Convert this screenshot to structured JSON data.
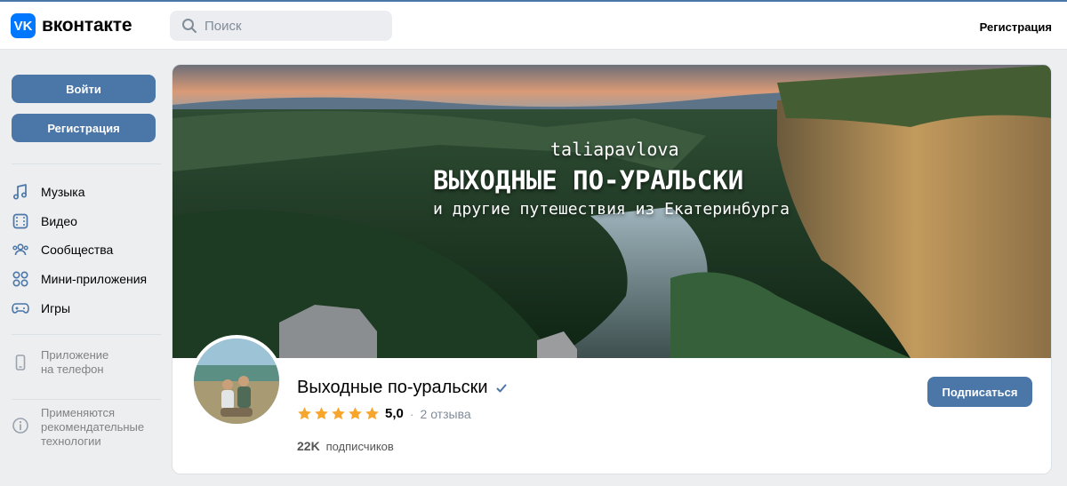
{
  "header": {
    "logo_glyph": "VK",
    "logo_text": "вконтакте",
    "search_placeholder": "Поиск",
    "register_link": "Регистрация"
  },
  "sidebar": {
    "login_button": "Войти",
    "register_button": "Регистрация",
    "nav": [
      {
        "icon": "music-icon",
        "label": "Музыка"
      },
      {
        "icon": "video-icon",
        "label": "Видео"
      },
      {
        "icon": "communities-icon",
        "label": "Сообщества"
      },
      {
        "icon": "mini-apps-icon",
        "label": "Мини-приложения"
      },
      {
        "icon": "games-icon",
        "label": "Игры"
      }
    ],
    "phone_app": {
      "icon": "phone-icon",
      "line1": "Приложение",
      "line2": "на телефон"
    },
    "recommendations": {
      "icon": "info-icon",
      "line1": "Применяются",
      "line2": "рекомендательные",
      "line3": "технологии"
    }
  },
  "group": {
    "cover": {
      "username": "taliapavlova",
      "title": "ВЫХОДНЫЕ ПО-УРАЛЬСКИ",
      "subtitle": "и другие путешествия из Екатеринбурга"
    },
    "name": "Выходные по-уральски",
    "verified_icon": "verified-check-icon",
    "rating_value": "5,0",
    "rating_stars": 5,
    "reviews": "2 отзыва",
    "subscribers_count": "22K",
    "subscribers_label": "подписчиков",
    "subscribe_button": "Подписаться"
  },
  "colors": {
    "accent": "#4a76a8",
    "vk_blue": "#0077ff",
    "star": "#f7a62b",
    "background": "#edeef0"
  }
}
